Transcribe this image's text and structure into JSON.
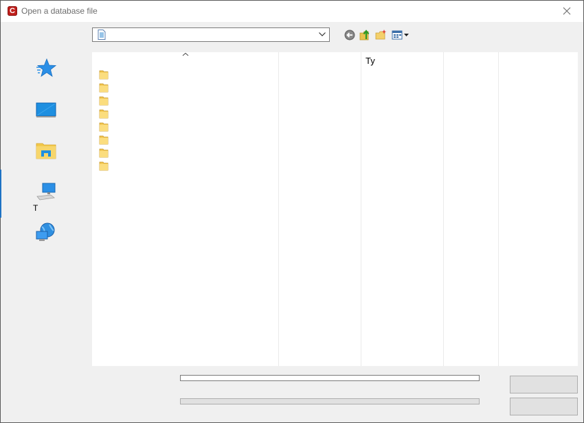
{
  "window": {
    "title": "Open a database file",
    "app_icon_letter": "C",
    "colors": {
      "app_icon": "#c0201c",
      "title_text": "#6d6d6d"
    }
  },
  "toolbar": {
    "look_in_value": "",
    "icons": [
      "back-icon",
      "up-folder-icon",
      "new-folder-icon",
      "view-menu-icon"
    ]
  },
  "places": {
    "items": [
      "quick-access",
      "desktop",
      "libraries",
      "this-pc",
      "network"
    ],
    "this_pc_label": "T"
  },
  "file_list": {
    "columns": [
      {
        "label": ""
      },
      {
        "label": ""
      },
      {
        "label": "Ty"
      },
      {
        "label": ""
      },
      {
        "label": ""
      }
    ],
    "folder_count": 8
  },
  "bottom": {
    "file_name_value": "",
    "file_type_value": "",
    "open_label": "",
    "cancel_label": ""
  }
}
